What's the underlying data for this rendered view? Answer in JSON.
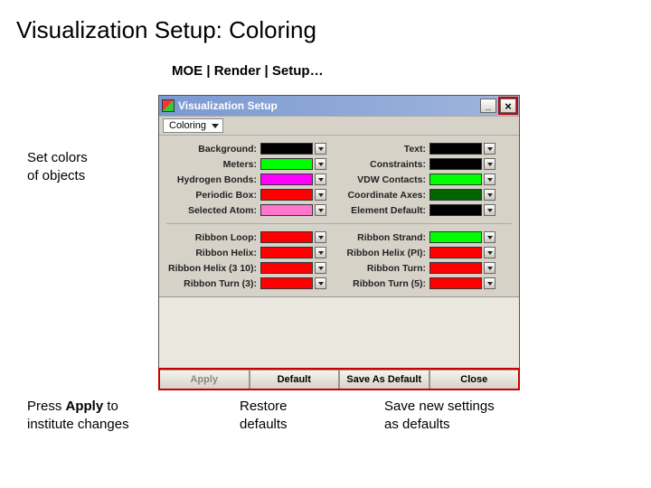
{
  "slide": {
    "title": "Visualization Setup: Coloring",
    "breadcrumb": "MOE | Render | Setup…"
  },
  "annotations": {
    "left_top": "Set colors\nof objects",
    "press_apply_1": "Press ",
    "press_apply_bold": "Apply",
    "press_apply_2": " to\ninstitute changes",
    "restore": "Restore\ndefaults",
    "save_new": "Save new settings\nas defaults"
  },
  "window": {
    "title": "Visualization Setup",
    "tab": "Coloring",
    "section1": [
      {
        "l1": "Background:",
        "c1": "#000000",
        "l2": "Text:",
        "c2": "#000000"
      },
      {
        "l1": "Meters:",
        "c1": "#00ff00",
        "l2": "Constraints:",
        "c2": "#000000"
      },
      {
        "l1": "Hydrogen Bonds:",
        "c1": "#ff00ff",
        "l2": "VDW Contacts:",
        "c2": "#00ff00"
      },
      {
        "l1": "Periodic Box:",
        "c1": "#ff0000",
        "l2": "Coordinate Axes:",
        "c2": "#006600"
      },
      {
        "l1": "Selected Atom:",
        "c1": "#ff77cc",
        "l2": "Element Default:",
        "c2": "#000000"
      }
    ],
    "section2": [
      {
        "l1": "Ribbon Loop:",
        "c1": "#ff0000",
        "l2": "Ribbon Strand:",
        "c2": "#00ff00"
      },
      {
        "l1": "Ribbon Helix:",
        "c1": "#ff0000",
        "l2": "Ribbon Helix (PI):",
        "c2": "#ff0000"
      },
      {
        "l1": "Ribbon Helix (3 10):",
        "c1": "#ff0000",
        "l2": "Ribbon Turn:",
        "c2": "#ff0000"
      },
      {
        "l1": "Ribbon Turn (3):",
        "c1": "#ff0000",
        "l2": "Ribbon Turn (5):",
        "c2": "#ff0000"
      }
    ],
    "footer": {
      "apply": "Apply",
      "default": "Default",
      "save_as_default": "Save As Default",
      "close": "Close"
    }
  }
}
